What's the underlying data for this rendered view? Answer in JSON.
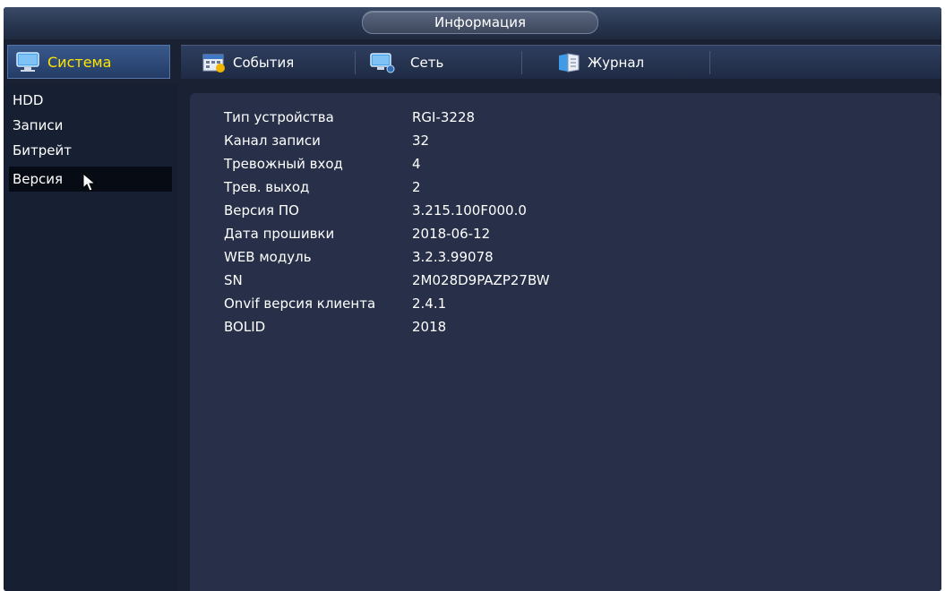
{
  "window": {
    "title": "Информация"
  },
  "tabs": {
    "active": {
      "label": "Система",
      "icon": "monitor-icon"
    },
    "items": [
      {
        "label": "События",
        "icon": "calendar-alarm-icon"
      },
      {
        "label": "Сеть",
        "icon": "network-monitor-icon"
      },
      {
        "label": "Журнал",
        "icon": "logbook-icon"
      }
    ]
  },
  "sidebar": {
    "items": [
      {
        "label": "HDD"
      },
      {
        "label": "Записи"
      },
      {
        "label": "Битрейт"
      },
      {
        "label": "Версия",
        "active": true
      }
    ]
  },
  "info": {
    "rows": [
      {
        "label": "Тип устройства",
        "value": "RGI-3228"
      },
      {
        "label": "Канал записи",
        "value": "32"
      },
      {
        "label": "Тревожный вход",
        "value": "4"
      },
      {
        "label": "Трев. выход",
        "value": "2"
      },
      {
        "label": "Версия ПО",
        "value": "3.215.100F000.0"
      },
      {
        "label": "Дата прошивки",
        "value": "2018-06-12"
      },
      {
        "label": "WEB модуль",
        "value": "3.2.3.99078"
      },
      {
        "label": "SN",
        "value": "2M028D9PAZP27BW"
      },
      {
        "label": "Onvif версия клиента",
        "value": "2.4.1"
      },
      {
        "label": "BOLID",
        "value": "2018"
      }
    ]
  },
  "colors": {
    "accent_yellow": "#ffe400",
    "background": "#1a2133",
    "panel": "#273048"
  }
}
